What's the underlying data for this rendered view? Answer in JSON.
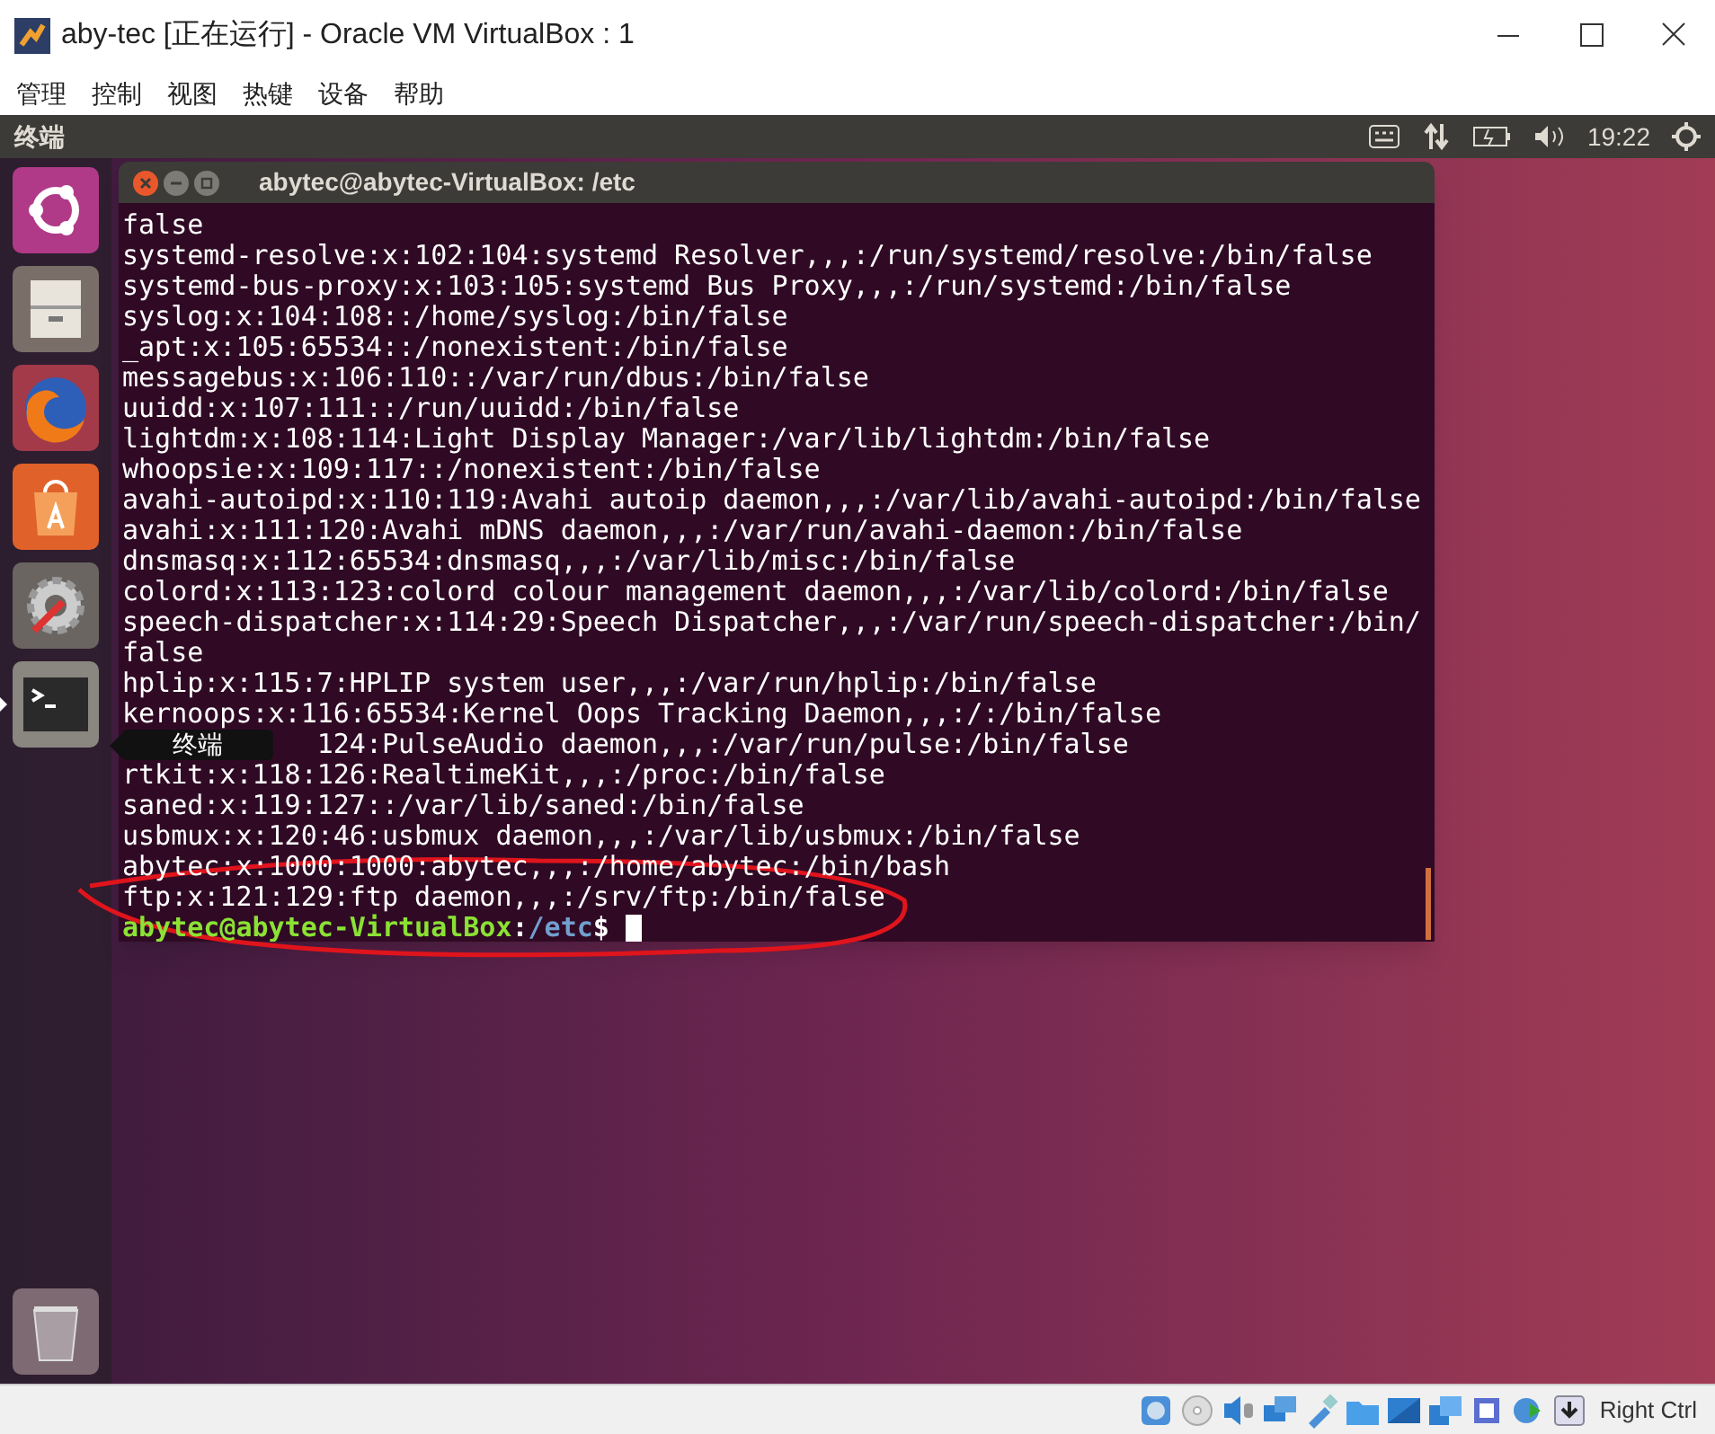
{
  "window": {
    "title": "aby-tec [正在运行] - Oracle VM VirtualBox : 1"
  },
  "menu_bar": [
    "管理",
    "控制",
    "视图",
    "热键",
    "设备",
    "帮助"
  ],
  "top_panel": {
    "app_name": "终端",
    "clock": "19:22"
  },
  "launcher": {
    "items": [
      {
        "kind": "ubuntu",
        "running": false
      },
      {
        "kind": "files",
        "running": false
      },
      {
        "kind": "firefox",
        "running": false
      },
      {
        "kind": "software",
        "running": false
      },
      {
        "kind": "settings",
        "running": false
      },
      {
        "kind": "terminal",
        "running": true
      },
      {
        "kind": "trash",
        "running": false
      }
    ],
    "tooltip": "终端"
  },
  "terminal": {
    "title": "abytec@abytec-VirtualBox: /etc",
    "lines": [
      {
        "kind": "line",
        "text": "false"
      },
      {
        "kind": "line",
        "text": "systemd-resolve:x:102:104:systemd Resolver,,,:/run/systemd/resolve:/bin/false"
      },
      {
        "kind": "line",
        "text": "systemd-bus-proxy:x:103:105:systemd Bus Proxy,,,:/run/systemd:/bin/false"
      },
      {
        "kind": "line",
        "text": "syslog:x:104:108::/home/syslog:/bin/false"
      },
      {
        "kind": "line",
        "text": "_apt:x:105:65534::/nonexistent:/bin/false"
      },
      {
        "kind": "line",
        "text": "messagebus:x:106:110::/var/run/dbus:/bin/false"
      },
      {
        "kind": "line",
        "text": "uuidd:x:107:111::/run/uuidd:/bin/false"
      },
      {
        "kind": "line",
        "text": "lightdm:x:108:114:Light Display Manager:/var/lib/lightdm:/bin/false"
      },
      {
        "kind": "line",
        "text": "whoopsie:x:109:117::/nonexistent:/bin/false"
      },
      {
        "kind": "line",
        "text": "avahi-autoipd:x:110:119:Avahi autoip daemon,,,:/var/lib/avahi-autoipd:/bin/false"
      },
      {
        "kind": "line",
        "text": "avahi:x:111:120:Avahi mDNS daemon,,,:/var/run/avahi-daemon:/bin/false"
      },
      {
        "kind": "line",
        "text": "dnsmasq:x:112:65534:dnsmasq,,,:/var/lib/misc:/bin/false"
      },
      {
        "kind": "line",
        "text": "colord:x:113:123:colord colour management daemon,,,:/var/lib/colord:/bin/false"
      },
      {
        "kind": "line",
        "text": "speech-dispatcher:x:114:29:Speech Dispatcher,,,:/var/run/speech-dispatcher:/bin/"
      },
      {
        "kind": "line",
        "text": "false"
      },
      {
        "kind": "line",
        "text": "hplip:x:115:7:HPLIP system user,,,:/var/run/hplip:/bin/false"
      },
      {
        "kind": "line",
        "text": "kernoops:x:116:65534:Kernel Oops Tracking Daemon,,,:/:/bin/false"
      },
      {
        "kind": "behind_tooltip",
        "text": "124:PulseAudio daemon,,,:/var/run/pulse:/bin/false"
      },
      {
        "kind": "line",
        "text": "rtkit:x:118:126:RealtimeKit,,,:/proc:/bin/false"
      },
      {
        "kind": "line",
        "text": "saned:x:119:127::/var/lib/saned:/bin/false"
      },
      {
        "kind": "line",
        "text": "usbmux:x:120:46:usbmux daemon,,,:/var/lib/usbmux:/bin/false"
      },
      {
        "kind": "line",
        "text": "abytec:x:1000:1000:abytec,,,:/home/abytec:/bin/bash"
      },
      {
        "kind": "line",
        "text": "ftp:x:121:129:ftp daemon,,,:/srv/ftp:/bin/false"
      }
    ],
    "prompt": {
      "user_host": "abytec@abytec-VirtualBox",
      "separator": ":",
      "path": "/etc",
      "symbol": "$"
    }
  },
  "status_bar": {
    "host_key": "Right Ctrl"
  }
}
